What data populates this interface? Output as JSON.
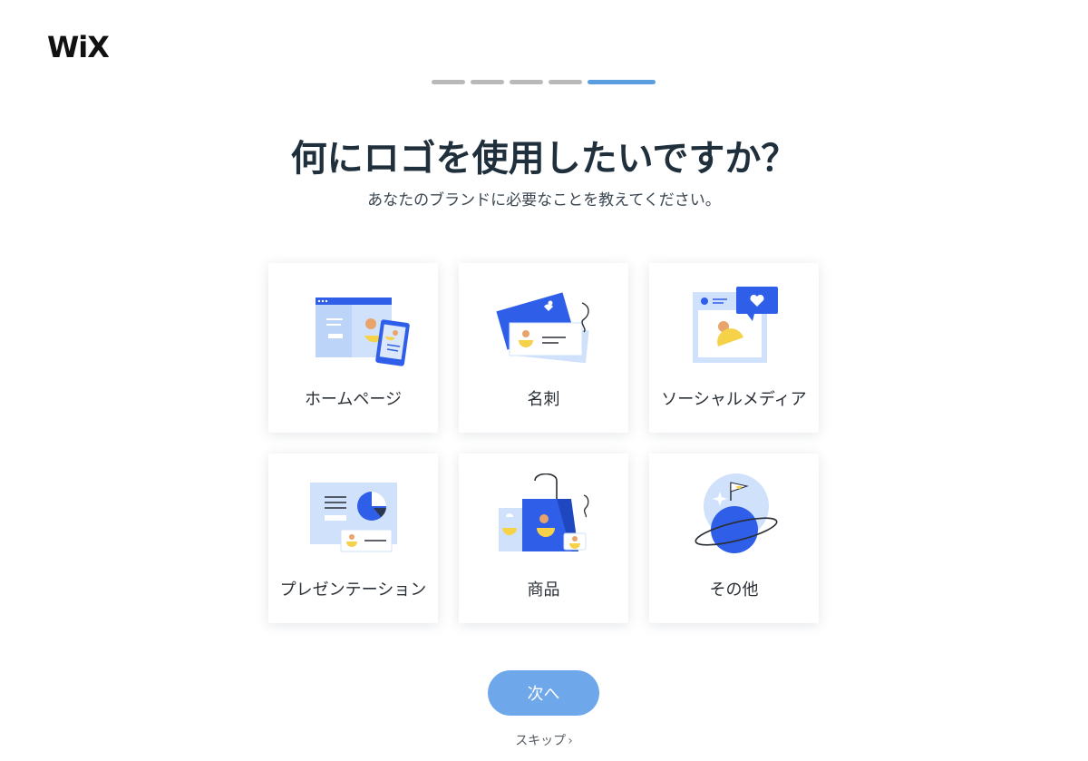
{
  "brand": {
    "logo_text": "WiX"
  },
  "progress": {
    "steps": 5,
    "current": 5
  },
  "header": {
    "title": "何にロゴを使用したいですか？",
    "subtitle": "あなたのブランドに必要なことを教えてください。"
  },
  "options": [
    {
      "label": "ホームページ",
      "icon": "homepage-icon"
    },
    {
      "label": "名刺",
      "icon": "business-card-icon"
    },
    {
      "label": "ソーシャルメディア",
      "icon": "social-media-icon"
    },
    {
      "label": "プレゼンテーション",
      "icon": "presentation-icon"
    },
    {
      "label": "商品",
      "icon": "product-icon"
    },
    {
      "label": "その他",
      "icon": "other-planet-icon"
    }
  ],
  "actions": {
    "next_label": "次へ",
    "skip_label": "スキップ",
    "skip_chevron": "›"
  },
  "colors": {
    "accent_blue": "#2f5fe8",
    "light_blue": "#cfe1fb",
    "yellow": "#f6d248",
    "orange": "#e8a46a",
    "button": "#6ea8ea"
  }
}
